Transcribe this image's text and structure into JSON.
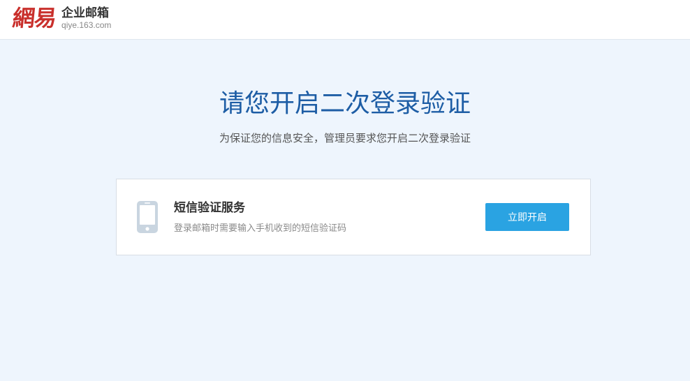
{
  "header": {
    "logo_mark": "網易",
    "product_name": "企业邮箱",
    "domain": "qiye.163.com",
    "brand_color": "#c9302c"
  },
  "main": {
    "title": "请您开启二次登录验证",
    "subtitle": "为保证您的信息安全，管理员要求您开启二次登录验证",
    "title_color": "#1d5da5"
  },
  "sms_card": {
    "icon": "mobile-phone-icon",
    "title": "短信验证服务",
    "description": "登录邮箱时需要输入手机收到的短信验证码",
    "button_label": "立即开启",
    "button_color": "#2aa3e2"
  }
}
